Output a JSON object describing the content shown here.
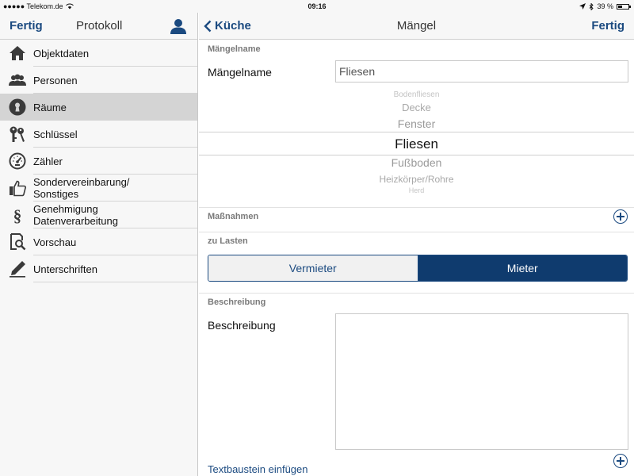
{
  "status_bar": {
    "carrier": "●●●●● Telekom.de",
    "time": "09:16",
    "battery_text": "39 %",
    "battery_level": 0.39
  },
  "left_nav": {
    "done_label": "Fertig",
    "title": "Protokoll",
    "user_icon": "user-icon"
  },
  "menu": {
    "items": [
      {
        "label": "Objektdaten",
        "icon": "house-icon",
        "active": false
      },
      {
        "label": "Personen",
        "icon": "people-icon",
        "active": false
      },
      {
        "label": "Räume",
        "icon": "keyhole-icon",
        "active": true
      },
      {
        "label": "Schlüssel",
        "icon": "keys-icon",
        "active": false
      },
      {
        "label": "Zähler",
        "icon": "gauge-icon",
        "active": false
      },
      {
        "label": "Sondervereinbarung/\nSonstiges",
        "icon": "thumbs-up-icon",
        "active": false
      },
      {
        "label": "Genehmigung\nDatenverarbeitung",
        "icon": "paragraph-icon",
        "active": false
      },
      {
        "label": "Vorschau",
        "icon": "preview-icon",
        "active": false
      },
      {
        "label": "Unterschriften",
        "icon": "pen-icon",
        "active": false
      }
    ]
  },
  "right_nav": {
    "back_label": "Küche",
    "title": "Mängel",
    "done_label": "Fertig"
  },
  "maengelname": {
    "section_title": "Mängelname",
    "field_label": "Mängelname",
    "value": "Fliesen"
  },
  "picker": {
    "options": [
      "Bodenfliesen",
      "Decke",
      "Fenster",
      "Fliesen",
      "Fußboden",
      "Heizkörper/Rohre",
      "Herd"
    ],
    "selected_index": 3
  },
  "massnahmen": {
    "section_title": "Maßnahmen"
  },
  "zu_lasten": {
    "section_title": "zu Lasten",
    "options": [
      "Vermieter",
      "Mieter"
    ],
    "selected": "Mieter"
  },
  "beschreibung": {
    "section_title": "Beschreibung",
    "field_label": "Beschreibung",
    "value": ""
  },
  "textbaustein": {
    "link_label": "Textbaustein einfügen"
  },
  "colors": {
    "accent": "#1b4a80",
    "segment_selected": "#0f3b6e",
    "sidebar_bg": "#f7f7f7",
    "active_row": "#d4d4d4"
  }
}
